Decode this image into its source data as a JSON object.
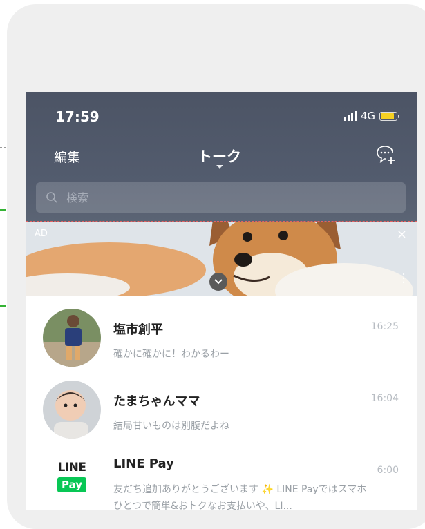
{
  "status_bar": {
    "time": "17:59",
    "network": "4G"
  },
  "header": {
    "edit_label": "編集",
    "title": "トーク"
  },
  "search": {
    "placeholder": "検索"
  },
  "ad": {
    "label": "AD",
    "close_label": "×"
  },
  "chats": [
    {
      "name": "塩市創平",
      "message": "確かに確かに！わかるわー",
      "time": "16:25"
    },
    {
      "name": "たまちゃんママ",
      "message": "結局甘いものは別腹だよね",
      "time": "16:04"
    },
    {
      "name": "LINE Pay",
      "message": "友だち追加ありがとうございます ✨ LINE Payではスマホひとつで簡単&おトクなお支払いや、LI...",
      "time": "6:00",
      "logo_line": "LINE",
      "logo_pay": "Pay"
    }
  ],
  "colors": {
    "header_bg": "#4f586a",
    "line_green": "#08c755",
    "battery": "#f5d022"
  }
}
